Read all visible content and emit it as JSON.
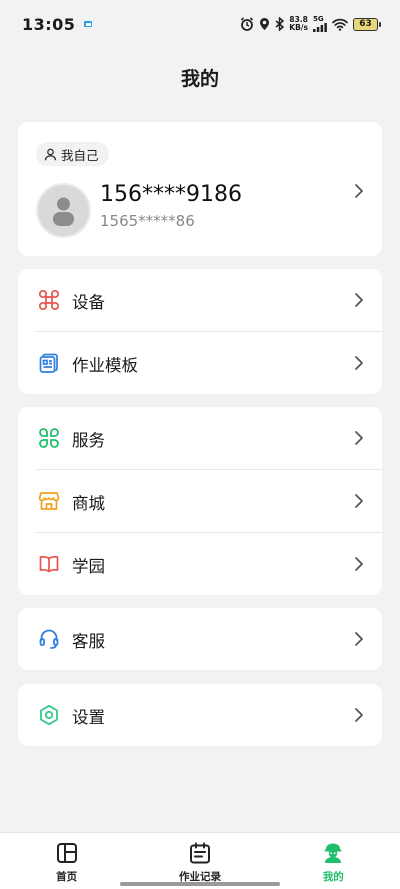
{
  "status_bar": {
    "time": "13:05",
    "net_speed_value": "83.8",
    "net_speed_unit": "KB/s",
    "network": "5G",
    "battery": "63"
  },
  "page": {
    "title": "我的"
  },
  "profile": {
    "tag": "我自己",
    "phone": "156****9186",
    "sub_phone": "1565*****86"
  },
  "menu": {
    "device": "设备",
    "template": "作业模板",
    "service": "服务",
    "mall": "商城",
    "academy": "学园",
    "support": "客服",
    "settings": "设置"
  },
  "nav": {
    "home": "首页",
    "records": "作业记录",
    "mine": "我的"
  },
  "colors": {
    "accent": "#1fbf6b",
    "device_icon": "#e8534a",
    "template_icon": "#2f7fe0",
    "service_icon": "#1fbf6b",
    "mall_icon": "#f0a020",
    "academy_icon": "#e8534a",
    "support_icon": "#2f7fe0",
    "settings_icon": "#37c88a"
  }
}
